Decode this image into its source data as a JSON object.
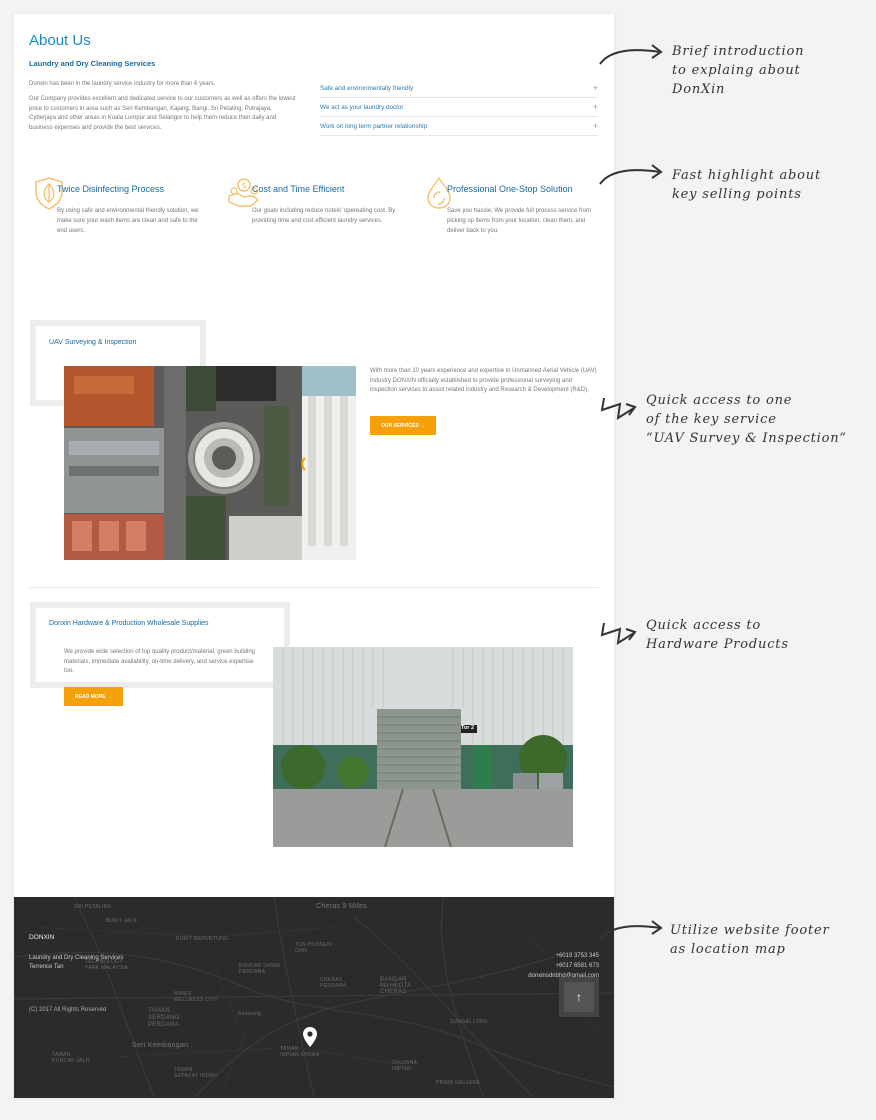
{
  "about": {
    "title": "About Us",
    "subtitle": "Laundry and Dry Cleaning Services",
    "p1": "Donxin has been in the laundry service industry for more than 6 years.",
    "p2": "Our Company provides excellent and dedicated service to our customers as well as offers the lowest price to customers in area such as Seri Kembangan, Kajang, Bangi, Sri Petaling, Putrajaya, Cyberjaya and other areas in Kuala Lumpur and Selangor to help them reduce their daily and business expenses and provide the best services.",
    "accordion": [
      {
        "label": "Safe and environmentally friendly"
      },
      {
        "label": "We act as your laundry doctor"
      },
      {
        "label": "Work on long term partner relationship"
      }
    ]
  },
  "features": [
    {
      "title": "Twice Disinfecting Process",
      "text": "By using safe and environmental friendly solution, we make sure your wash items are clean and safe to the end users.",
      "icon": "leaf-shield-icon"
    },
    {
      "title": "Cost and Time Efficient",
      "text": "Our goals including reduce hotels' opereating cost. By providing time and cost efficient laundry services.",
      "icon": "coins-hand-icon"
    },
    {
      "title": "Professional One-Stop Solution",
      "text": "Save you hassle. We provide full process service from picking up items from your location, clean them, and deliver back to you.",
      "icon": "water-drop-icon"
    }
  ],
  "uav": {
    "title": "UAV Surveying & Inspection",
    "text": "With more than 10 years experience and expertise in Unmanned Aerial Vehicle (UAV) industry DONXIN officially established to provide professional surveying and inspection services to assist related industry and Research & Development (R&D).",
    "button": "OUR SERVICES →"
  },
  "hardware": {
    "title": "Donxin Hardware & Production Wholesale Supplies",
    "text": "We provide wide selection of top quality product/material, green building materials, immediate availability, on-time delivery, and service expertise too.",
    "button": "READ MORE →",
    "door_sign": "Tor 2"
  },
  "footer": {
    "brand": "DONXIN",
    "line1": "Laundry and Dry Cleaning Services",
    "line2": "Terrence Tan",
    "copyright": "(C) 2017 All Rights Reserved",
    "phone1": "+6019 3753 345",
    "phone2": "+6017 6581 673",
    "email": "donxinsdnbhd@gmail.com",
    "up_icon": "↑",
    "map_labels": {
      "sri_petaling": "SRI PETALING",
      "cheras_9": "Cheras 9 Miles",
      "taman_tech": "TAMAN\nTECHNOLOGY",
      "bukit_jalil": "BUKIT JALIL",
      "bukit_beruntung": "BUKIT BERUNTUNG",
      "bukit_jalil_park": "TECHNOLOGY\nPARK MALAYSIA",
      "tun_hussein": "TUN HUSSEIN\nONN",
      "bandar_damai": "BANDAR DAMAI\nPERDANA",
      "cheras_perdana": "CHERAS\nPERDANA",
      "bandar_mahkota": "BANDAR\nMAHKOTA\nCHERAS",
      "mines": "MINES\nWELLNESS CITY",
      "taman_serdang": "TAMAN\nSERDANG\nPERDANA",
      "seri_kembangan": "Seri Kembangan",
      "balakong": "Balakong",
      "taman_impian": "TAMAN\nIMPIAN EHSAN",
      "taman_puncak": "TAMAN\nPUNCAK JALIL",
      "taman_sepakat": "TAMAN\nSEPAKAT INDAH",
      "sg_long": "SUNGAI LONG",
      "saujana": "SAUJANA\nIMPIAN",
      "prima": "PRIMA SAUJANA"
    }
  },
  "annotations": [
    "Brief introduction\nto explaing about\nDonXin",
    "Fast highlight about\nkey selling points",
    "Quick access to one\nof the key service\n“UAV Survey & Inspection”",
    "Quick access to\nHardware Products",
    "Utilize website footer\nas location map"
  ],
  "colors": {
    "accent_blue": "#1a8ac8",
    "heading_blue": "#1a6aa0",
    "button_orange": "#f5a20a",
    "footer_bg": "#2b2b2b"
  }
}
